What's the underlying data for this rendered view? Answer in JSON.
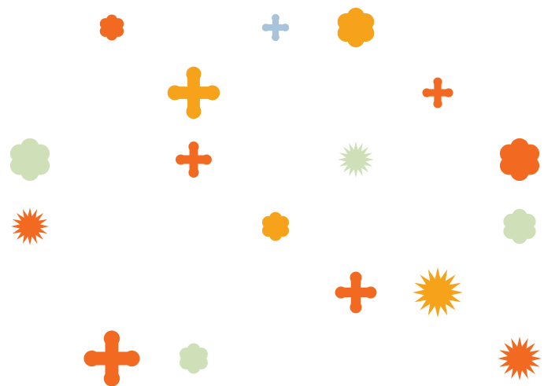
{
  "colors": {
    "orange": "#F26A21",
    "amber": "#F7A21B",
    "sage": "#CFE0B8",
    "steel": "#A9C3DA"
  },
  "rows": [
    [
      {
        "shape": "flower",
        "fill": "photo",
        "name": "photo-hands-tablet"
      },
      {
        "shape": "flower",
        "fill": "orange",
        "name": "orange-flower-icon"
      },
      {
        "shape": "flower",
        "fill": "photo",
        "name": "photo-meeting-group"
      },
      {
        "shape": "cross",
        "fill": "steel",
        "name": "steel-cross-icon"
      },
      {
        "shape": "flower",
        "fill": "amber",
        "name": "amber-flower-icon"
      },
      {
        "shape": "blob",
        "fill": "photo",
        "name": "photo-auditorium-audience"
      },
      {
        "shape": "flower",
        "fill": "photo",
        "name": "photo-presenter-whiteboard"
      }
    ],
    [
      {
        "shape": "cross",
        "fill": "photo",
        "name": "photo-man-glasses"
      },
      {
        "shape": "star",
        "fill": "photo",
        "name": "photo-woman-smiling"
      },
      {
        "shape": "cross",
        "fill": "amber",
        "name": "amber-cross-icon"
      },
      {
        "shape": "star",
        "fill": "photo",
        "name": "photo-lab-work"
      },
      {
        "shape": "cross",
        "fill": "photo",
        "name": "photo-server-cables"
      },
      {
        "shape": "cross",
        "fill": "orange",
        "name": "orange-cross-icon"
      },
      {
        "shape": "star",
        "fill": "photo",
        "name": "photo-woman-portrait"
      }
    ],
    [
      {
        "shape": "flower",
        "fill": "sage",
        "name": "sage-flower-icon"
      },
      {
        "shape": "blob",
        "fill": "photo",
        "name": "photo-microscope-blue"
      },
      {
        "shape": "cross",
        "fill": "orange",
        "name": "orange-cross-icon"
      },
      {
        "shape": "blob",
        "fill": "photo",
        "name": "photo-lab-flask"
      },
      {
        "shape": "star",
        "fill": "sage",
        "name": "sage-star-icon"
      },
      {
        "shape": "blob",
        "fill": "photo",
        "name": "photo-scientists-lab"
      },
      {
        "shape": "flower",
        "fill": "orange",
        "name": "orange-flower-icon"
      }
    ],
    [
      {
        "shape": "star",
        "fill": "orange",
        "name": "orange-star-icon"
      },
      {
        "shape": "blob",
        "fill": "photo",
        "name": "photo-scientist-microscope"
      },
      {
        "shape": "blob",
        "fill": "photo",
        "name": "photo-documents-pen"
      },
      {
        "shape": "flower",
        "fill": "amber",
        "name": "amber-flower-icon"
      },
      {
        "shape": "star",
        "fill": "photo",
        "name": "photo-man-smiling"
      },
      {
        "shape": "flower",
        "fill": "photo",
        "name": "photo-woman-headshot"
      },
      {
        "shape": "flower",
        "fill": "sage",
        "name": "sage-flower-icon"
      }
    ],
    [
      {
        "shape": "blob",
        "fill": "photo",
        "name": "photo-two-men"
      },
      {
        "shape": "cross",
        "fill": "photo",
        "name": "photo-puzzle-pieces"
      },
      {
        "shape": "cross",
        "fill": "photo",
        "name": "photo-woman-laptop"
      },
      {
        "shape": "cross",
        "fill": "photo",
        "name": "photo-handshake"
      },
      {
        "shape": "cross",
        "fill": "orange",
        "name": "orange-cross-icon"
      },
      {
        "shape": "star",
        "fill": "amber",
        "name": "amber-star-icon"
      },
      {
        "shape": "blob",
        "fill": "photo",
        "name": "photo-team-overhead"
      }
    ],
    [
      {
        "shape": "star",
        "fill": "photo",
        "name": "photo-golden-abstract"
      },
      {
        "shape": "cross",
        "fill": "orange",
        "name": "orange-cross-icon"
      },
      {
        "shape": "flower",
        "fill": "sage",
        "name": "sage-flower-icon"
      },
      {
        "shape": "blob",
        "fill": "photo",
        "name": "photo-notebook-pen"
      },
      {
        "shape": "blob",
        "fill": "photo",
        "name": "photo-woman-office"
      },
      {
        "shape": "cross",
        "fill": "photo",
        "name": "photo-cursor-hand"
      },
      {
        "shape": "star",
        "fill": "orange",
        "name": "orange-star-icon"
      }
    ]
  ]
}
